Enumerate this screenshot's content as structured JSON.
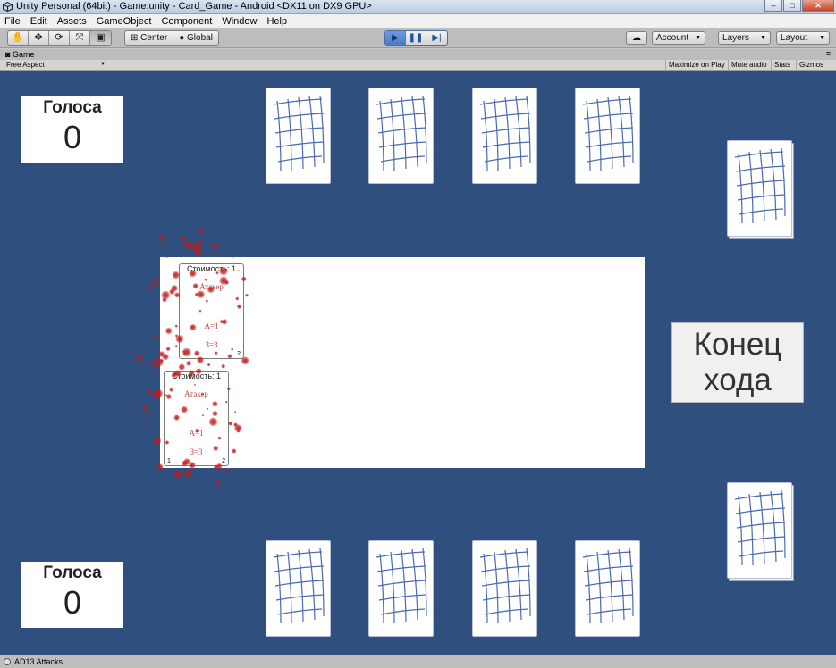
{
  "window": {
    "title": "Unity Personal (64bit) - Game.unity - Card_Game - Android <DX11 on DX9 GPU>"
  },
  "menu": [
    "File",
    "Edit",
    "Assets",
    "GameObject",
    "Component",
    "Window",
    "Help"
  ],
  "toolbar": {
    "pivot_label": "Center",
    "space_label": "Global",
    "account_label": "Account",
    "layers_label": "Layers",
    "layout_label": "Layout"
  },
  "game_view": {
    "tab_label": "Game",
    "aspect_label": "Free Aspect",
    "options": [
      "Maximize on Play",
      "Mute audio",
      "Stats",
      "Gizmos"
    ]
  },
  "opponent_votes": {
    "label": "Голоса",
    "value": "0"
  },
  "player_votes": {
    "label": "Голоса",
    "value": "0"
  },
  "end_turn": {
    "line1": "Конец",
    "line2": "хода"
  },
  "field_cards": [
    {
      "cost": "Стоимость: 1",
      "name": "Атакер",
      "attack": "А=1",
      "defense": "З=3",
      "left": "1",
      "right": "2"
    },
    {
      "cost": "Стоимость: 1",
      "name": "Атакер",
      "attack": "А=1",
      "defense": "З=3",
      "left": "1",
      "right": "2"
    }
  ],
  "status": {
    "message": "AD13 Attacks"
  },
  "colors": {
    "table": "#2f507f",
    "card_grid": "#4a6bb0",
    "blood": "#c01818",
    "stat_text": "#c44a4a"
  }
}
